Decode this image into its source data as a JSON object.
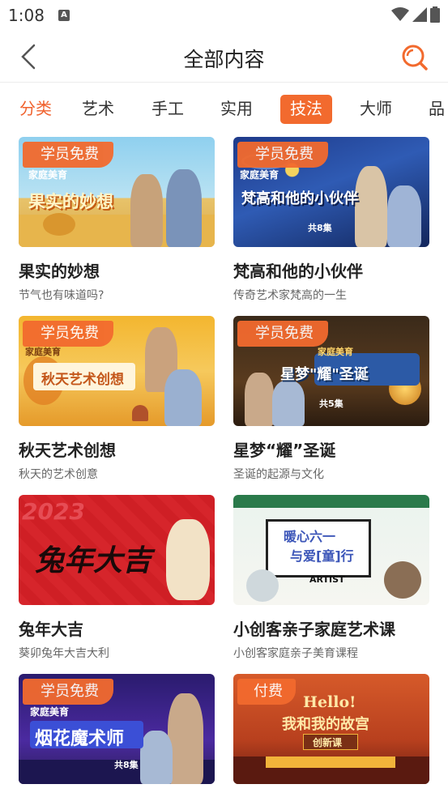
{
  "status_bar": {
    "time": "1:08",
    "notification_letter": "A"
  },
  "header": {
    "title": "全部内容"
  },
  "tabs": [
    {
      "label": "分类"
    },
    {
      "label": "艺术"
    },
    {
      "label": "手工"
    },
    {
      "label": "实用"
    },
    {
      "label": "技法"
    },
    {
      "label": "大师"
    },
    {
      "label": "品"
    }
  ],
  "cards": [
    {
      "badge": "学员免费",
      "title": "果实的妙想",
      "subtitle": "节气也有味道吗?",
      "art_title": "果实的妙想",
      "art_tag": "家庭美育"
    },
    {
      "badge": "学员免费",
      "title": "梵高和他的小伙伴",
      "subtitle": "传奇艺术家梵高的一生",
      "art_title": "梵高和他的小伙伴",
      "art_tag": "家庭美育",
      "art_note": "共8集"
    },
    {
      "badge": "学员免费",
      "title": "秋天艺术创想",
      "subtitle": "秋天的艺术创意",
      "art_title": "秋天艺术创想",
      "art_tag": "家庭美育"
    },
    {
      "badge": "学员免费",
      "title": "星梦“耀”圣诞",
      "subtitle": "圣诞的起源与文化",
      "art_title": "星梦\"耀\"圣诞",
      "art_tag": "家庭美育",
      "art_note": "共5集"
    },
    {
      "title": "兔年大吉",
      "subtitle": "葵卯兔年大吉大利",
      "art_title": "兔年大吉",
      "art_year": "2023"
    },
    {
      "title": "小创客亲子家庭艺术课",
      "subtitle": "小创客家庭亲子美育课程",
      "art_line1": "暖心六一",
      "art_line2": "与爱[童]行",
      "art_note": "ARTIST"
    },
    {
      "badge": "学员免费",
      "art_title": "烟花魔术师",
      "art_tag": "家庭美育",
      "art_note": "共8集"
    },
    {
      "badge": "付费",
      "art_line1": "Hello!",
      "art_line2": "我和我的故宫",
      "art_note": "创新课"
    }
  ]
}
